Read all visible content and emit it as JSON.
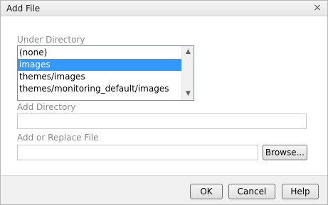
{
  "dialog": {
    "title": "Add File",
    "close_symbol": "×"
  },
  "under_directory": {
    "label": "Under Directory",
    "items": [
      "(none)",
      "images",
      "themes/images",
      "themes/monitoring_default/images"
    ],
    "selected": "images"
  },
  "add_directory": {
    "label": "Add Directory",
    "value": ""
  },
  "replace_file": {
    "label": "Add or Replace File",
    "value": "",
    "browse_label": "Browse..."
  },
  "buttons": {
    "ok": "OK",
    "cancel": "Cancel",
    "help": "Help"
  },
  "colors": {
    "selection": "#3399ff",
    "footer_bg": "#f0f0f0"
  },
  "icons": {
    "close": "close-icon",
    "scroll_up": "scroll-up-icon",
    "scroll_down": "scroll-down-icon"
  }
}
